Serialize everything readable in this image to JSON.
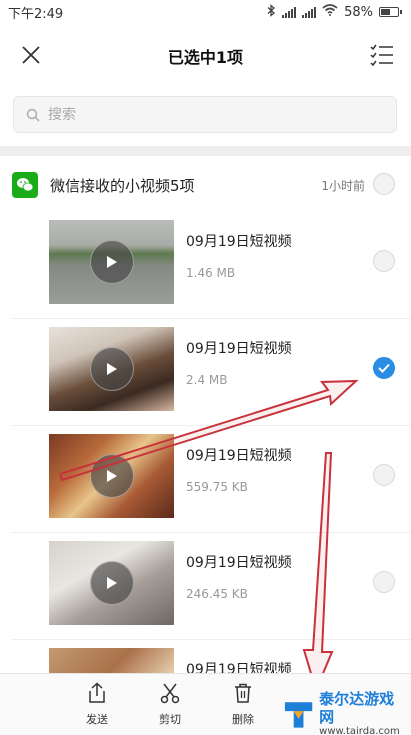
{
  "status_bar": {
    "time": "下午2:49",
    "battery": "58%",
    "battery_level": 0.58
  },
  "header": {
    "title": "已选中1项"
  },
  "search": {
    "placeholder": "搜索"
  },
  "group": {
    "title": "微信接收的小视频5项",
    "time": "1小时前",
    "selected": false
  },
  "videos": [
    {
      "title": "09月19日短视频",
      "size": "1.46 MB",
      "selected": false
    },
    {
      "title": "09月19日短视频",
      "size": "2.4 MB",
      "selected": true
    },
    {
      "title": "09月19日短视频",
      "size": "559.75 KB",
      "selected": false
    },
    {
      "title": "09月19日短视频",
      "size": "246.45 KB",
      "selected": false
    },
    {
      "title": "09月19日短视频",
      "size": "",
      "selected": false
    }
  ],
  "actions": {
    "send": "发送",
    "cut": "剪切",
    "delete": "删除"
  },
  "watermark": {
    "name": "泰尔达游戏网",
    "url": "www.tairda.com"
  },
  "colors": {
    "accent": "#2a8de3",
    "wechat_green": "#1aad19",
    "annotation_red": "#c8323a"
  }
}
